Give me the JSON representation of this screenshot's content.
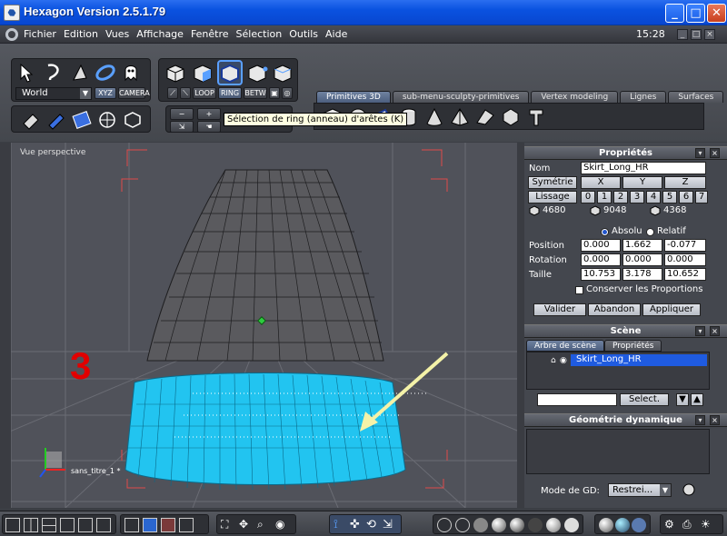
{
  "window": {
    "title": "Hexagon Version 2.5.1.79",
    "minimize": "_",
    "maximize": "□",
    "close": "✕"
  },
  "menu": {
    "items": [
      "Fichier",
      "Edition",
      "Vues",
      "Affichage",
      "Fenêtre",
      "Sélection",
      "Outils",
      "Aide"
    ],
    "clock": "15:28"
  },
  "toolbar": {
    "coord_system": "World",
    "xyz_button": "XYZ",
    "camera_button": "CAMERA",
    "loop_button": "LOOP",
    "ring_button": "RING",
    "betw_button": "BETW",
    "minus_button": "−",
    "plus_button": "+",
    "tooltip": "Sélection de ring (anneau) d'arêtes (K)"
  },
  "tabs": [
    {
      "label": "Primitives 3D",
      "active": true
    },
    {
      "label": "sub-menu-sculpty-primitives",
      "active": false
    },
    {
      "label": "Vertex modeling",
      "active": false
    },
    {
      "label": "Lignes",
      "active": false
    },
    {
      "label": "Surfaces",
      "active": false
    }
  ],
  "viewport": {
    "label": "Vue perspective",
    "step_number": "3",
    "object_name": "sans_titre_1 *",
    "highlight_color": "#22c4f0"
  },
  "properties": {
    "header": "Propriétés",
    "name_label": "Nom",
    "name_value": "Skirt_Long_HR",
    "symmetry_button": "Symétrie",
    "axes": [
      "X",
      "Y",
      "Z"
    ],
    "smoothing_button": "Lissage",
    "smoothing_levels": [
      "0",
      "1",
      "2",
      "3",
      "4",
      "5",
      "6",
      "7"
    ],
    "counts": [
      "4680",
      "9048",
      "4368"
    ],
    "absolute_label": "Absolu",
    "relative_label": "Relatif",
    "position_label": "Position",
    "position": [
      "0.000",
      "1.662",
      "-0.077"
    ],
    "rotation_label": "Rotation",
    "rotation": [
      "0.000",
      "0.000",
      "0.000"
    ],
    "size_label": "Taille",
    "size": [
      "10.753",
      "3.178",
      "10.652"
    ],
    "keep_proportions": "Conserver les Proportions",
    "validate_button": "Valider",
    "abort_button": "Abandon",
    "apply_button": "Appliquer"
  },
  "scene": {
    "header": "Scène",
    "tab_tree": "Arbre de scène",
    "tab_props": "Propriétés",
    "item": "Skirt_Long_HR",
    "select_button": "Select."
  },
  "dyngeo": {
    "header": "Géométrie dynamique",
    "mode_label": "Mode de GD:",
    "mode_value": "Restrei..."
  }
}
